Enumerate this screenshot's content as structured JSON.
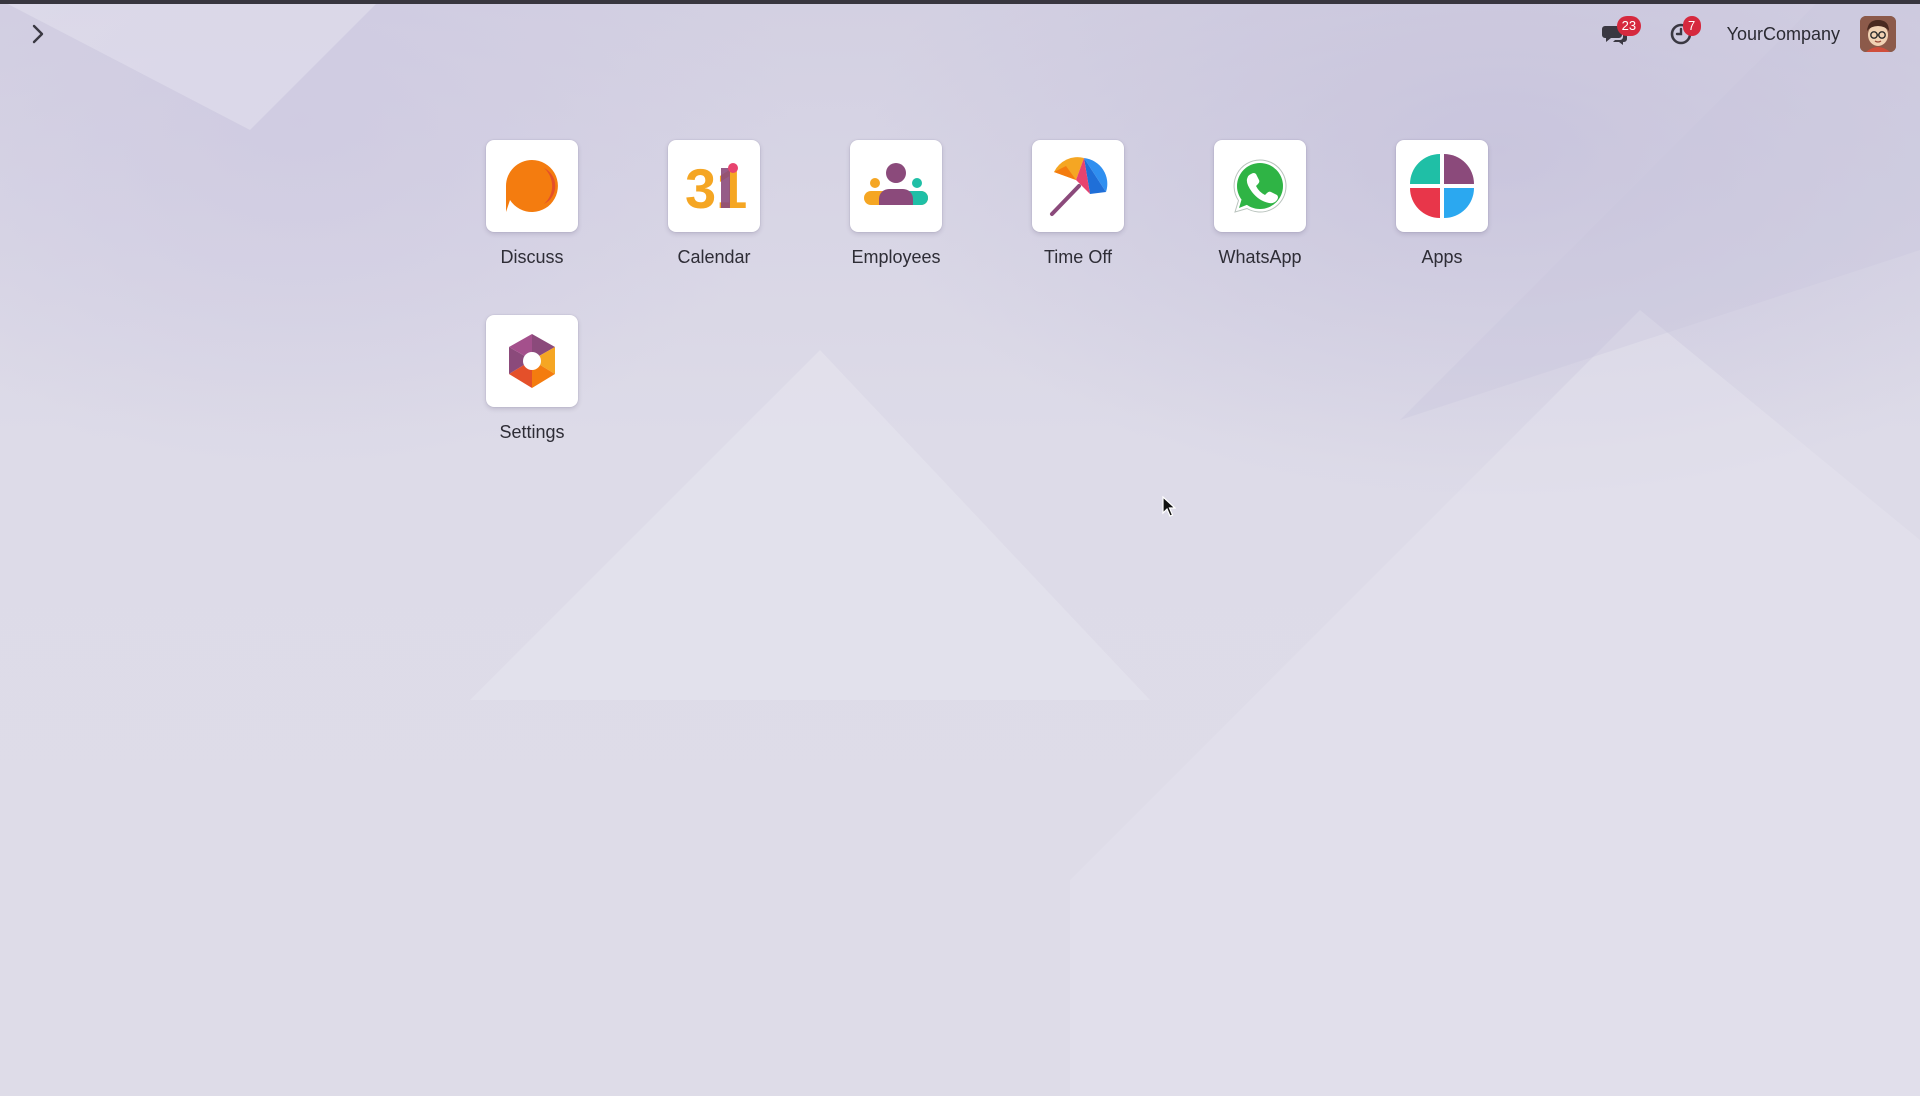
{
  "navbar": {
    "messages_badge": "23",
    "activities_badge": "7",
    "company": "YourCompany",
    "badge_color": "#d6293e"
  },
  "apps": [
    {
      "label": "Discuss",
      "icon": "discuss-icon"
    },
    {
      "label": "Calendar",
      "icon": "calendar-icon",
      "icon_text": "31"
    },
    {
      "label": "Employees",
      "icon": "employees-icon"
    },
    {
      "label": "Time Off",
      "icon": "time-off-icon"
    },
    {
      "label": "WhatsApp",
      "icon": "whatsapp-icon"
    },
    {
      "label": "Apps",
      "icon": "apps-icon"
    },
    {
      "label": "Settings",
      "icon": "settings-icon"
    }
  ]
}
